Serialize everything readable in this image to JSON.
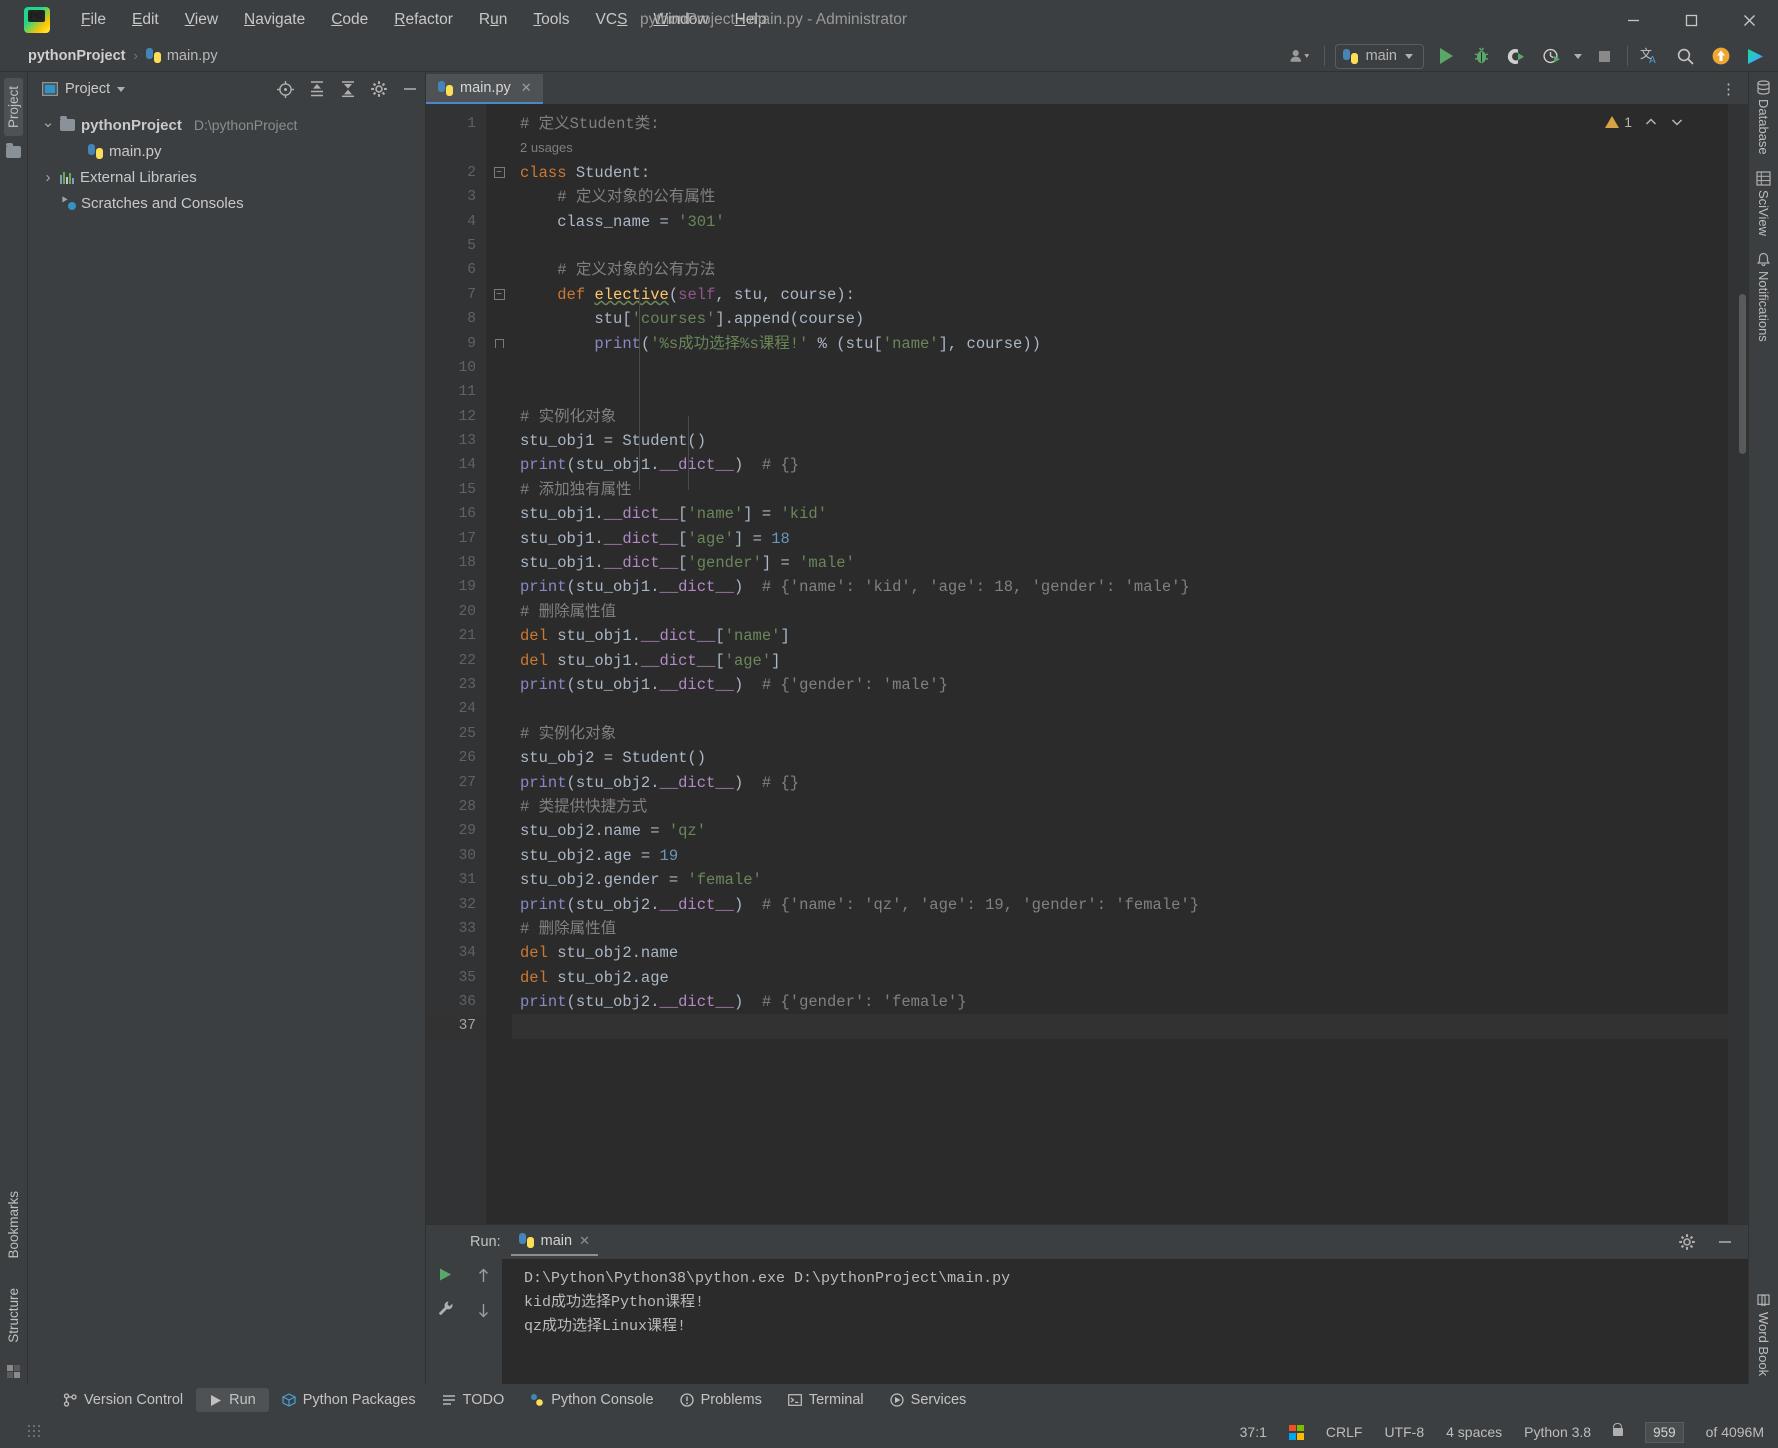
{
  "window": {
    "title": "pythonProject - main.py - Administrator",
    "minimize_label": "─",
    "maximize_label": "☐",
    "close_label": "✕"
  },
  "menubar": {
    "items": [
      {
        "label": "File",
        "mnemonic": "F"
      },
      {
        "label": "Edit",
        "mnemonic": "E"
      },
      {
        "label": "View",
        "mnemonic": "V"
      },
      {
        "label": "Navigate",
        "mnemonic": "N"
      },
      {
        "label": "Code",
        "mnemonic": "C"
      },
      {
        "label": "Refactor",
        "mnemonic": "R"
      },
      {
        "label": "Run",
        "mnemonic": "u"
      },
      {
        "label": "Tools",
        "mnemonic": "T"
      },
      {
        "label": "VCS",
        "mnemonic": "S"
      },
      {
        "label": "Window",
        "mnemonic": "W"
      },
      {
        "label": "Help",
        "mnemonic": "H"
      }
    ]
  },
  "breadcrumb": {
    "project": "pythonProject",
    "separator": "›",
    "file": "main.py"
  },
  "toolbar": {
    "run_config_name": "main",
    "icons": [
      "user-dropdown-icon",
      "run-icon",
      "debug-icon",
      "run-coverage-icon",
      "profile-icon",
      "stop-icon",
      "translate-icon",
      "search-icon",
      "update-icon",
      "ide-eval-icon"
    ]
  },
  "project_panel": {
    "title": "Project",
    "tools": [
      "locate-icon",
      "expand-all-icon",
      "collapse-all-icon",
      "settings-icon",
      "hide-icon"
    ],
    "tree": [
      {
        "label": "pythonProject",
        "path": "D:\\pythonProject",
        "kind": "folder",
        "expanded": true,
        "depth": 0
      },
      {
        "label": "main.py",
        "path": "",
        "kind": "python-file",
        "expanded": null,
        "depth": 1
      },
      {
        "label": "External Libraries",
        "path": "",
        "kind": "library",
        "expanded": false,
        "depth": 0
      },
      {
        "label": "Scratches and Consoles",
        "path": "",
        "kind": "scratches",
        "expanded": null,
        "depth": 0
      }
    ]
  },
  "left_strip": {
    "top_tab": "Project",
    "bottom_tabs": [
      "Bookmarks",
      "Structure"
    ]
  },
  "right_strip": {
    "tabs": [
      "Database",
      "SciView",
      "Notifications",
      "Word Book"
    ]
  },
  "editor": {
    "tabs": [
      {
        "label": "main.py",
        "active": true,
        "close": "✕"
      }
    ],
    "warning_count": "1",
    "inlay_hint": "2 usages",
    "total_lines": 37,
    "current_line": 37,
    "lines": [
      {
        "n": 1,
        "html": "<span class=\"c\"># 定义Student类:</span>"
      },
      {
        "n": 2,
        "html": "<span class=\"k\">class</span> Student:"
      },
      {
        "n": 3,
        "html": "    <span class=\"c\"># 定义对象的公有属性</span>"
      },
      {
        "n": 4,
        "html": "    class_name = <span class=\"s\">'301'</span>"
      },
      {
        "n": 5,
        "html": ""
      },
      {
        "n": 6,
        "html": "    <span class=\"c\"># 定义对象的公有方法</span>"
      },
      {
        "n": 7,
        "html": "    <span class=\"k\">def</span> <span class=\"f wavy\">elective</span>(<span class=\"p\">self</span>, stu, course):"
      },
      {
        "n": 8,
        "html": "        stu[<span class=\"s\">'courses'</span>].append(course)"
      },
      {
        "n": 9,
        "html": "        <span class=\"b\">print</span>(<span class=\"s\">'%s成功选择%s课程!'</span> % (stu[<span class=\"s\">'name'</span>], course))"
      },
      {
        "n": 10,
        "html": ""
      },
      {
        "n": 11,
        "html": ""
      },
      {
        "n": 12,
        "html": "<span class=\"c\"># 实例化对象</span>"
      },
      {
        "n": 13,
        "html": "stu_obj1 = Student()"
      },
      {
        "n": 14,
        "html": "<span class=\"b\">print</span>(stu_obj1.<span class=\"d\">__dict__</span>)  <span class=\"c\"># {}</span>"
      },
      {
        "n": 15,
        "html": "<span class=\"c\"># 添加独有属性</span>"
      },
      {
        "n": 16,
        "html": "stu_obj1.<span class=\"d\">__dict__</span>[<span class=\"s\">'name'</span>] = <span class=\"s\">'kid'</span>"
      },
      {
        "n": 17,
        "html": "stu_obj1.<span class=\"d\">__dict__</span>[<span class=\"s\">'age'</span>] = <span class=\"n\">18</span>"
      },
      {
        "n": 18,
        "html": "stu_obj1.<span class=\"d\">__dict__</span>[<span class=\"s\">'gender'</span>] = <span class=\"s\">'male'</span>"
      },
      {
        "n": 19,
        "html": "<span class=\"b\">print</span>(stu_obj1.<span class=\"d\">__dict__</span>)  <span class=\"c\"># {'name': 'kid', 'age': 18, 'gender': 'male'}</span>"
      },
      {
        "n": 20,
        "html": "<span class=\"c\"># 删除属性值</span>"
      },
      {
        "n": 21,
        "html": "<span class=\"k\">del</span> stu_obj1.<span class=\"d\">__dict__</span>[<span class=\"s\">'name'</span>]"
      },
      {
        "n": 22,
        "html": "<span class=\"k\">del</span> stu_obj1.<span class=\"d\">__dict__</span>[<span class=\"s\">'age'</span>]"
      },
      {
        "n": 23,
        "html": "<span class=\"b\">print</span>(stu_obj1.<span class=\"d\">__dict__</span>)  <span class=\"c\"># {'gender': 'male'}</span>"
      },
      {
        "n": 24,
        "html": ""
      },
      {
        "n": 25,
        "html": "<span class=\"c\"># 实例化对象</span>"
      },
      {
        "n": 26,
        "html": "stu_obj2 = Student()"
      },
      {
        "n": 27,
        "html": "<span class=\"b\">print</span>(stu_obj2.<span class=\"d\">__dict__</span>)  <span class=\"c\"># {}</span>"
      },
      {
        "n": 28,
        "html": "<span class=\"c\"># 类提供快捷方式</span>"
      },
      {
        "n": 29,
        "html": "stu_obj2.name = <span class=\"s\">'qz'</span>"
      },
      {
        "n": 30,
        "html": "stu_obj2.age = <span class=\"n\">19</span>"
      },
      {
        "n": 31,
        "html": "stu_obj2.gender = <span class=\"s\">'female'</span>"
      },
      {
        "n": 32,
        "html": "<span class=\"b\">print</span>(stu_obj2.<span class=\"d\">__dict__</span>)  <span class=\"c\"># {'name': 'qz', 'age': 19, 'gender': 'female'}</span>"
      },
      {
        "n": 33,
        "html": "<span class=\"c\"># 删除属性值</span>"
      },
      {
        "n": 34,
        "html": "<span class=\"k\">del</span> stu_obj2.name"
      },
      {
        "n": 35,
        "html": "<span class=\"k\">del</span> stu_obj2.age"
      },
      {
        "n": 36,
        "html": "<span class=\"b\">print</span>(stu_obj2.<span class=\"d\">__dict__</span>)  <span class=\"c\"># {'gender': 'female'}</span>"
      },
      {
        "n": 37,
        "html": ""
      }
    ]
  },
  "run_panel": {
    "label": "Run:",
    "tab_name": "main",
    "tab_close": "✕",
    "console_lines": [
      "D:\\Python\\Python38\\python.exe D:\\pythonProject\\main.py",
      "kid成功选择Python课程!",
      "qz成功选择Linux课程!"
    ],
    "tools": [
      "rerun-icon",
      "settings-icon",
      "up-arrow-icon",
      "down-arrow-icon",
      "wrench-icon",
      "gear-icon",
      "minimize-icon"
    ]
  },
  "bottom_tabs": [
    {
      "label": "Version Control",
      "icon": "branch-icon",
      "active": false
    },
    {
      "label": "Run",
      "icon": "run-icon",
      "active": true
    },
    {
      "label": "Python Packages",
      "icon": "package-icon",
      "active": false
    },
    {
      "label": "TODO",
      "icon": "todo-icon",
      "active": false
    },
    {
      "label": "Python Console",
      "icon": "console-icon",
      "active": false
    },
    {
      "label": "Problems",
      "icon": "problems-icon",
      "active": false
    },
    {
      "label": "Terminal",
      "icon": "terminal-icon",
      "active": false
    },
    {
      "label": "Services",
      "icon": "services-icon",
      "active": false
    }
  ],
  "statusbar": {
    "caret_position": "37:1",
    "line_separator": "CRLF",
    "encoding": "UTF-8",
    "indent": "4 spaces",
    "interpreter": "Python 3.8",
    "memory_used": "959",
    "memory_total": "of 4096M",
    "icons": [
      "windows-logo-icon",
      "lock-icon",
      "resize-grip-icon"
    ]
  },
  "colors": {
    "accent_blue": "#4a88c7",
    "run_green": "#59a869",
    "warn_orange": "#d9a343",
    "editor_bg": "#2b2b2b",
    "panel_bg": "#3c3f41"
  }
}
